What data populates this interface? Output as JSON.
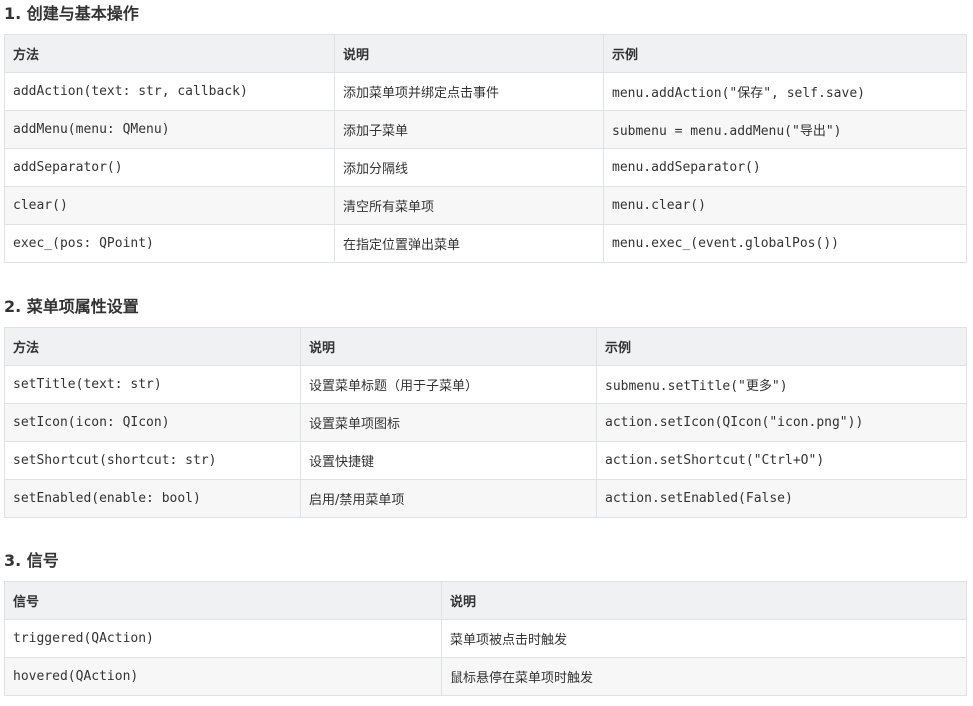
{
  "sections": [
    {
      "title": "1. 创建与基本操作",
      "headers": [
        "方法",
        "说明",
        "示例"
      ],
      "rows": [
        [
          "addAction(text: str, callback)",
          "添加菜单项并绑定点击事件",
          "menu.addAction(\"保存\", self.save)"
        ],
        [
          "addMenu(menu: QMenu)",
          "添加子菜单",
          "submenu = menu.addMenu(\"导出\")"
        ],
        [
          "addSeparator()",
          "添加分隔线",
          "menu.addSeparator()"
        ],
        [
          "clear()",
          "清空所有菜单项",
          "menu.clear()"
        ],
        [
          "exec_(pos: QPoint)",
          "在指定位置弹出菜单",
          "menu.exec_(event.globalPos())"
        ]
      ]
    },
    {
      "title": "2. 菜单项属性设置",
      "headers": [
        "方法",
        "说明",
        "示例"
      ],
      "rows": [
        [
          "setTitle(text: str)",
          "设置菜单标题（用于子菜单）",
          "submenu.setTitle(\"更多\")"
        ],
        [
          "setIcon(icon: QIcon)",
          "设置菜单项图标",
          "action.setIcon(QIcon(\"icon.png\"))"
        ],
        [
          "setShortcut(shortcut: str)",
          "设置快捷键",
          "action.setShortcut(\"Ctrl+O\")"
        ],
        [
          "setEnabled(enable: bool)",
          "启用/禁用菜单项",
          "action.setEnabled(False)"
        ]
      ]
    },
    {
      "title": "3. 信号",
      "headers": [
        "信号",
        "说明"
      ],
      "rows": [
        [
          "triggered(QAction)",
          "菜单项被点击时触发"
        ],
        [
          "hovered(QAction)",
          "鼠标悬停在菜单项时触发"
        ]
      ]
    }
  ]
}
